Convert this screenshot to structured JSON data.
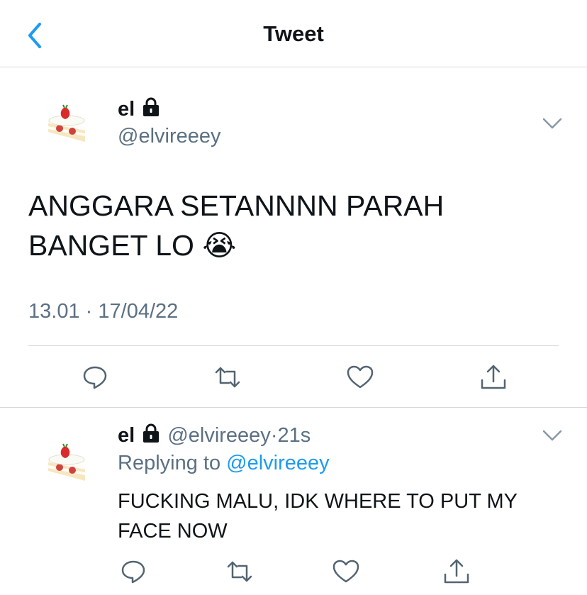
{
  "header": {
    "title": "Tweet",
    "back_icon": "chevron-left-icon"
  },
  "colors": {
    "accent": "#1d9bf0",
    "secondary_text": "#5b7083",
    "divider": "#d6d9dc"
  },
  "tweet": {
    "avatar_icon": "strawberry-cake-icon",
    "display_name": "el",
    "protected_icon": "lock-icon",
    "handle": "@elvireeey",
    "text_line1": "ANGGARA SETANNNN PARAH",
    "text_line2": "BANGET LO",
    "emoji": "😭",
    "time": "13.01",
    "separator": "·",
    "date": "17/04/22",
    "actions": [
      "reply-icon",
      "retweet-icon",
      "like-icon",
      "share-icon"
    ]
  },
  "reply": {
    "avatar_icon": "strawberry-cake-icon",
    "display_name": "el",
    "protected_icon": "lock-icon",
    "handle": "@elvireeey",
    "separator": "·",
    "age": "21s",
    "replying_prefix": "Replying to",
    "replying_handle": "@elvireeey",
    "text": "FUCKING MALU, IDK WHERE TO PUT MY FACE NOW",
    "actions": [
      "reply-icon",
      "retweet-icon",
      "like-icon",
      "share-icon"
    ]
  }
}
